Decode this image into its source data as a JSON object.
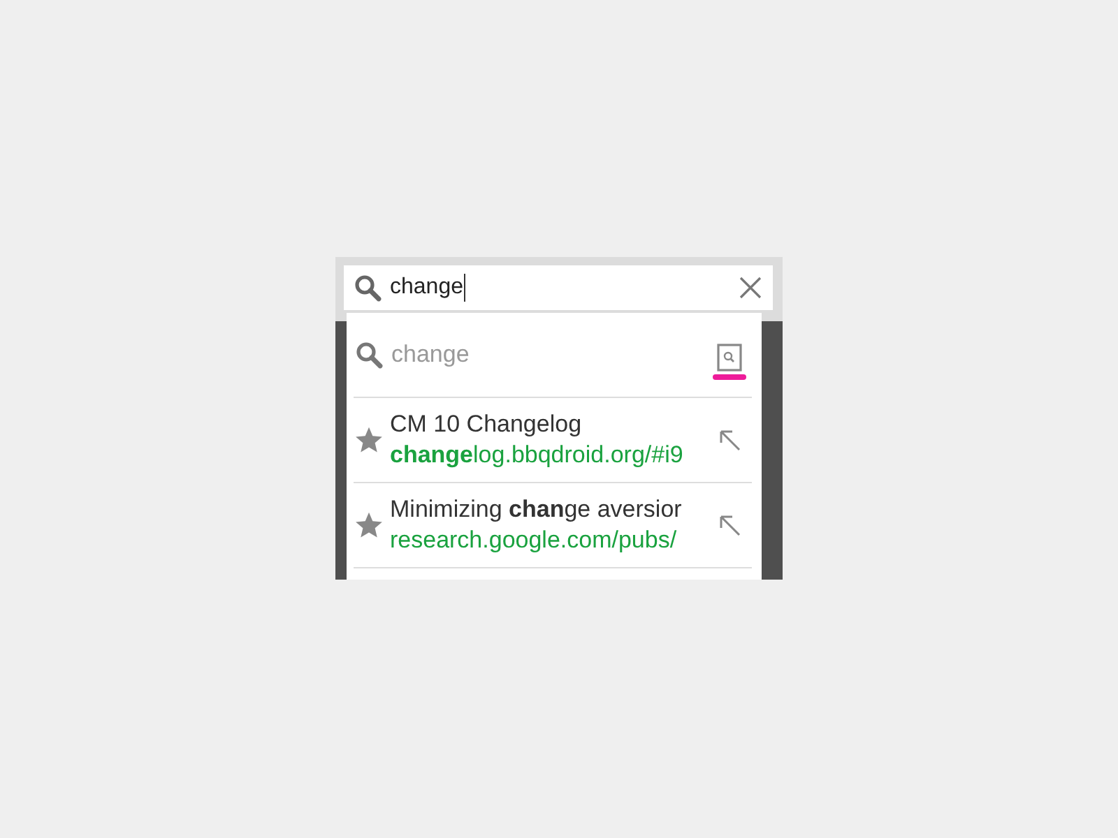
{
  "search": {
    "value": "change"
  },
  "suggestions": [
    {
      "kind": "query",
      "text": "change"
    },
    {
      "kind": "bookmark",
      "title": "CM 10 Changelog",
      "url": "**change**log.bbqdroid.org/#i9"
    },
    {
      "kind": "bookmark",
      "title": "Minimizing **chan**ge aversior",
      "url": "research.google.com/pubs/"
    }
  ]
}
